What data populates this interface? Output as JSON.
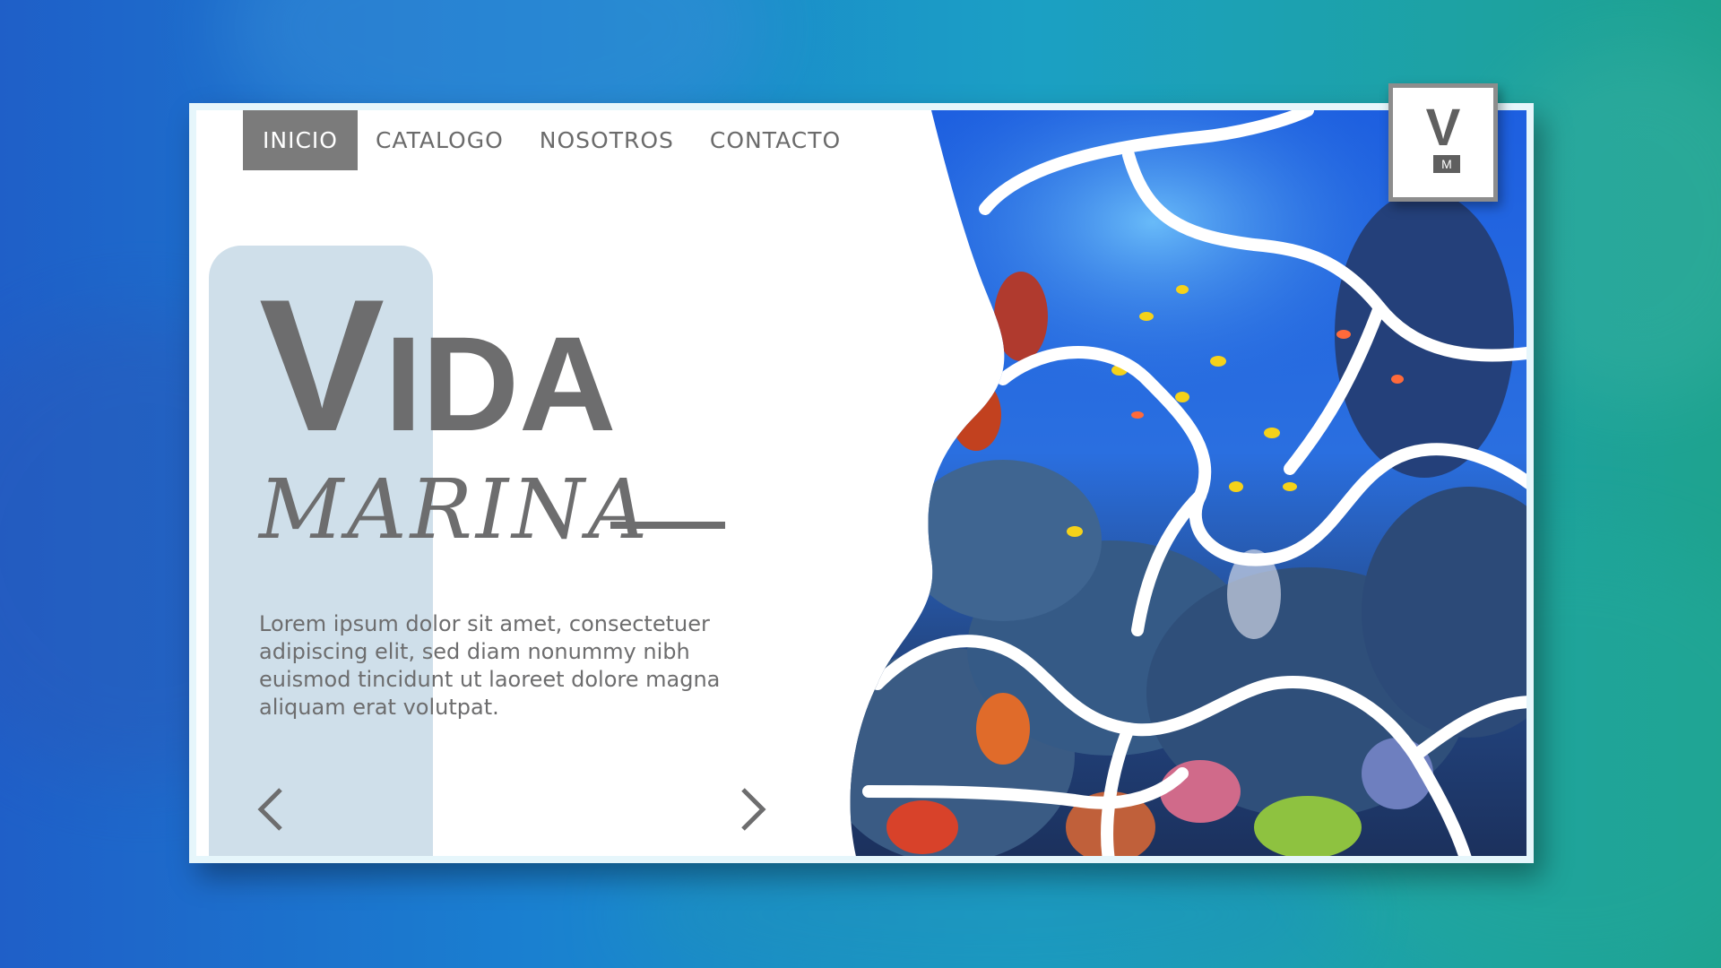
{
  "nav": {
    "items": [
      {
        "label": "INICIO",
        "active": true
      },
      {
        "label": "CATALOGO",
        "active": false
      },
      {
        "label": "NOSOTROS",
        "active": false
      },
      {
        "label": "CONTACTO",
        "active": false
      }
    ]
  },
  "hero": {
    "title_initial": "V",
    "title_rest": "IDA",
    "subtitle": "MARINA",
    "body": "Lorem ipsum dolor sit amet, consectetuer adipiscing elit, sed diam nonummy nibh euismod tincidunt ut laoreet dolore magna aliquam erat volutpat."
  },
  "logo": {
    "letter": "V",
    "sub_letter": "M"
  },
  "icons": {
    "prev": "chevron-left-icon",
    "next": "chevron-right-icon"
  },
  "colors": {
    "text_gray": "#6d6d6e",
    "nav_active_bg": "#7b7b7b",
    "side_panel": "#cfdfea",
    "bg_left": "#1f5fc8",
    "bg_right": "#1ea38f"
  }
}
